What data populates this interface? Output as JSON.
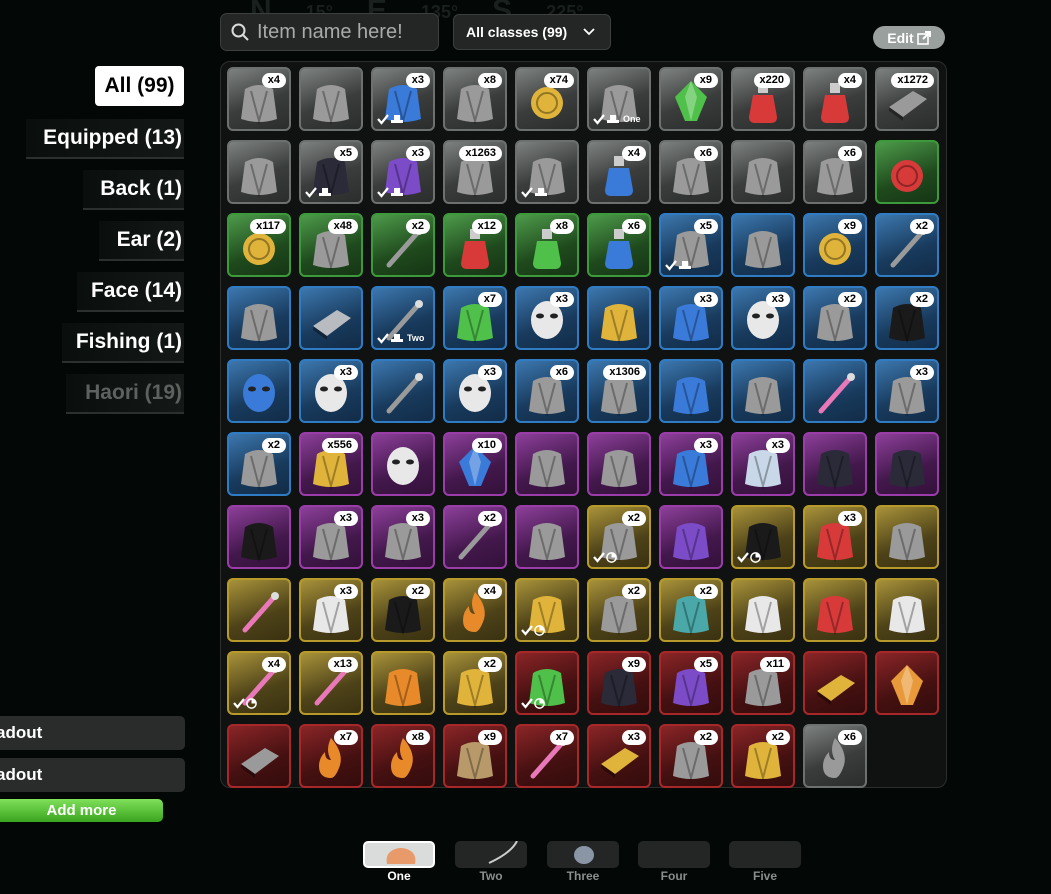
{
  "search": {
    "placeholder": "Item name here!"
  },
  "class_filter": {
    "label": "All classes (99)"
  },
  "edit_label": "Edit",
  "compass": [
    "N",
    "15°",
    "E",
    "135°",
    "S",
    "225°"
  ],
  "categories": [
    {
      "label": "All (99)",
      "selected": true
    },
    {
      "label": "Equipped (13)"
    },
    {
      "label": "Back (1)"
    },
    {
      "label": "Ear (2)"
    },
    {
      "label": "Face (14)"
    },
    {
      "label": "Fishing (1)"
    },
    {
      "label": "Haori (19)"
    }
  ],
  "loadouts": [
    "adout",
    "adout"
  ],
  "add_more": "Add more",
  "rarity_colors": {
    "common": "#6c706e",
    "uncommon": "#3d9a3a",
    "rare": "#2f7cc4",
    "epic": "#9a3da9",
    "legendary": "#b79a2a",
    "mythic": "#a8282a"
  },
  "items": [
    {
      "r": "c",
      "count": "x4",
      "icon": "cloth-wrap-icon"
    },
    {
      "r": "c",
      "count": "",
      "icon": "goggles-icon"
    },
    {
      "r": "c",
      "count": "x3",
      "icon": "blue-scarf-icon",
      "eq": true
    },
    {
      "r": "c",
      "count": "x8",
      "icon": "robe-icon"
    },
    {
      "r": "c",
      "count": "x74",
      "icon": "gold-coin-icon"
    },
    {
      "r": "c",
      "count": "",
      "icon": "fist-icon",
      "eq": true,
      "slot": "One"
    },
    {
      "r": "c",
      "count": "x9",
      "icon": "green-gem-icon"
    },
    {
      "r": "c",
      "count": "x220",
      "icon": "red-vial-icon"
    },
    {
      "r": "c",
      "count": "x4",
      "icon": "red-potion-icon"
    },
    {
      "r": "c",
      "count": "x1272",
      "icon": "metal-plates-icon"
    },
    {
      "r": "c",
      "count": "",
      "icon": "fox-ears-icon"
    },
    {
      "r": "c",
      "count": "x5",
      "icon": "dark-scarf-icon",
      "eq": true
    },
    {
      "r": "c",
      "count": "x3",
      "icon": "purple-scarf-icon",
      "eq": true
    },
    {
      "r": "c",
      "count": "x1263",
      "icon": "bandage-icon"
    },
    {
      "r": "c",
      "count": "",
      "icon": "uniform-icon",
      "eq": true
    },
    {
      "r": "c",
      "count": "x4",
      "icon": "blue-potion-icon"
    },
    {
      "r": "c",
      "count": "x6",
      "icon": "eyepatch-icon"
    },
    {
      "r": "c",
      "count": "",
      "icon": "antenna-icon"
    },
    {
      "r": "c",
      "count": "x6",
      "icon": "headphones-icon"
    },
    {
      "r": "g",
      "count": "",
      "icon": "red-orb-icon"
    },
    {
      "r": "g",
      "count": "x117",
      "icon": "coin-stack-icon"
    },
    {
      "r": "g",
      "count": "x48",
      "icon": "horn-icon"
    },
    {
      "r": "g",
      "count": "x2",
      "icon": "wand-icon"
    },
    {
      "r": "g",
      "count": "x12",
      "icon": "red-potion-icon"
    },
    {
      "r": "g",
      "count": "x8",
      "icon": "green-potion-icon"
    },
    {
      "r": "g",
      "count": "x6",
      "icon": "blue-potion-icon"
    },
    {
      "r": "b",
      "count": "x5",
      "icon": "uniform-icon",
      "eq": true
    },
    {
      "r": "b",
      "count": "",
      "icon": "glasses-icon"
    },
    {
      "r": "b",
      "count": "x9",
      "icon": "coin-stack-icon"
    },
    {
      "r": "b",
      "count": "x2",
      "icon": "pin-icon"
    },
    {
      "r": "b",
      "count": "",
      "icon": "kimono-icon"
    },
    {
      "r": "b",
      "count": "",
      "icon": "silver-ore-icon"
    },
    {
      "r": "b",
      "count": "",
      "icon": "fishing-rod-icon",
      "eq": true,
      "slot": "Two"
    },
    {
      "r": "b",
      "count": "x7",
      "icon": "green-cloak-icon"
    },
    {
      "r": "b",
      "count": "x3",
      "icon": "fox-mask-icon"
    },
    {
      "r": "b",
      "count": "",
      "icon": "gold-shirt-icon"
    },
    {
      "r": "b",
      "count": "x3",
      "icon": "blue-kimono-icon"
    },
    {
      "r": "b",
      "count": "x3",
      "icon": "mask-icon"
    },
    {
      "r": "b",
      "count": "x2",
      "icon": "crown-icon"
    },
    {
      "r": "b",
      "count": "x2",
      "icon": "black-cape-icon"
    },
    {
      "r": "b",
      "count": "",
      "icon": "blue-mask-icon"
    },
    {
      "r": "b",
      "count": "x3",
      "icon": "oni-mask-icon"
    },
    {
      "r": "b",
      "count": "",
      "icon": "sword-icon"
    },
    {
      "r": "b",
      "count": "x3",
      "icon": "oni-mask-icon"
    },
    {
      "r": "b",
      "count": "x6",
      "icon": "scarf-icon"
    },
    {
      "r": "b",
      "count": "x1306",
      "icon": "sack-icon"
    },
    {
      "r": "b",
      "count": "",
      "icon": "blue-kimono-icon"
    },
    {
      "r": "b",
      "count": "",
      "icon": "necklace-icon"
    },
    {
      "r": "b",
      "count": "",
      "icon": "pink-wisp-icon"
    },
    {
      "r": "b",
      "count": "x3",
      "icon": "slime-icon"
    },
    {
      "r": "b",
      "count": "x2",
      "icon": "haori-icon"
    },
    {
      "r": "p",
      "count": "x556",
      "icon": "money-bag-icon"
    },
    {
      "r": "p",
      "count": "",
      "icon": "white-mask-icon"
    },
    {
      "r": "p",
      "count": "x10",
      "icon": "blue-crystal-icon"
    },
    {
      "r": "p",
      "count": "",
      "icon": "bead-necklace-icon"
    },
    {
      "r": "p",
      "count": "",
      "icon": "bat-icon"
    },
    {
      "r": "p",
      "count": "x3",
      "icon": "blue-bat-icon"
    },
    {
      "r": "p",
      "count": "x3",
      "icon": "light-cape-icon"
    },
    {
      "r": "p",
      "count": "",
      "icon": "dark-cape-icon"
    },
    {
      "r": "p",
      "count": "",
      "icon": "dark-blue-cape-icon"
    },
    {
      "r": "p",
      "count": "",
      "icon": "black-haori-icon"
    },
    {
      "r": "p",
      "count": "x3",
      "icon": "scythe-icon"
    },
    {
      "r": "p",
      "count": "x3",
      "icon": "scythe-icon"
    },
    {
      "r": "p",
      "count": "x2",
      "icon": "spear-icon"
    },
    {
      "r": "p",
      "count": "",
      "icon": "ghost-robe-icon"
    },
    {
      "r": "y",
      "count": "x2",
      "icon": "pants-icon",
      "eq": true,
      "timed": true
    },
    {
      "r": "p",
      "count": "",
      "icon": "purple-uniform-icon"
    },
    {
      "r": "y",
      "count": "",
      "icon": "black-hat-icon",
      "eq": true,
      "timed": true
    },
    {
      "r": "y",
      "count": "x3",
      "icon": "red-claw-icon"
    },
    {
      "r": "y",
      "count": "",
      "icon": "raven-icon"
    },
    {
      "r": "y",
      "count": "",
      "icon": "pink-haori-icon"
    },
    {
      "r": "y",
      "count": "x3",
      "icon": "white-cloth-icon"
    },
    {
      "r": "y",
      "count": "x2",
      "icon": "black-uniform-icon"
    },
    {
      "r": "y",
      "count": "x4",
      "icon": "flame-uniform-icon"
    },
    {
      "r": "y",
      "count": "",
      "icon": "fan-icon",
      "eq": true,
      "timed": true
    },
    {
      "r": "y",
      "count": "x2",
      "icon": "potato-sack-icon"
    },
    {
      "r": "y",
      "count": "x2",
      "icon": "teal-pants-icon"
    },
    {
      "r": "y",
      "count": "",
      "icon": "white-dress-icon"
    },
    {
      "r": "y",
      "count": "",
      "icon": "red-haori-icon"
    },
    {
      "r": "y",
      "count": "",
      "icon": "white-haori-icon"
    },
    {
      "r": "y",
      "count": "x4",
      "icon": "pink-outfit-icon",
      "eq": true,
      "timed": true
    },
    {
      "r": "y",
      "count": "x13",
      "icon": "pink-haori-icon"
    },
    {
      "r": "y",
      "count": "",
      "icon": "orange-outfit-icon"
    },
    {
      "r": "y",
      "count": "x2",
      "icon": "gold-fan-icon"
    },
    {
      "r": "r",
      "count": "",
      "icon": "green-scroll-icon",
      "eq": true,
      "timed": true
    },
    {
      "r": "r",
      "count": "x9",
      "icon": "dark-pants-icon"
    },
    {
      "r": "r",
      "count": "x5",
      "icon": "purple-uniform-icon"
    },
    {
      "r": "r",
      "count": "x11",
      "icon": "lantern-icon"
    },
    {
      "r": "r",
      "count": "",
      "icon": "gold-bar-icon"
    },
    {
      "r": "r",
      "count": "",
      "icon": "amber-crystal-icon"
    },
    {
      "r": "r",
      "count": "",
      "icon": "paper-stack-icon"
    },
    {
      "r": "r",
      "count": "x7",
      "icon": "fire-cape-icon"
    },
    {
      "r": "r",
      "count": "x8",
      "icon": "flame-icon"
    },
    {
      "r": "r",
      "count": "x9",
      "icon": "tan-cloak-icon"
    },
    {
      "r": "r",
      "count": "x7",
      "icon": "pink-crystal-icon"
    },
    {
      "r": "r",
      "count": "x3",
      "icon": "gold-ingot-icon"
    },
    {
      "r": "r",
      "count": "x2",
      "icon": "armor-icon"
    },
    {
      "r": "r",
      "count": "x2",
      "icon": "gold-scroll-icon"
    },
    {
      "r": "c",
      "count": "x6",
      "icon": "spark-icon"
    }
  ],
  "hotbar": [
    {
      "label": "One",
      "selected": true
    },
    {
      "label": "Two"
    },
    {
      "label": "Three"
    },
    {
      "label": "Four"
    },
    {
      "label": "Five"
    }
  ]
}
